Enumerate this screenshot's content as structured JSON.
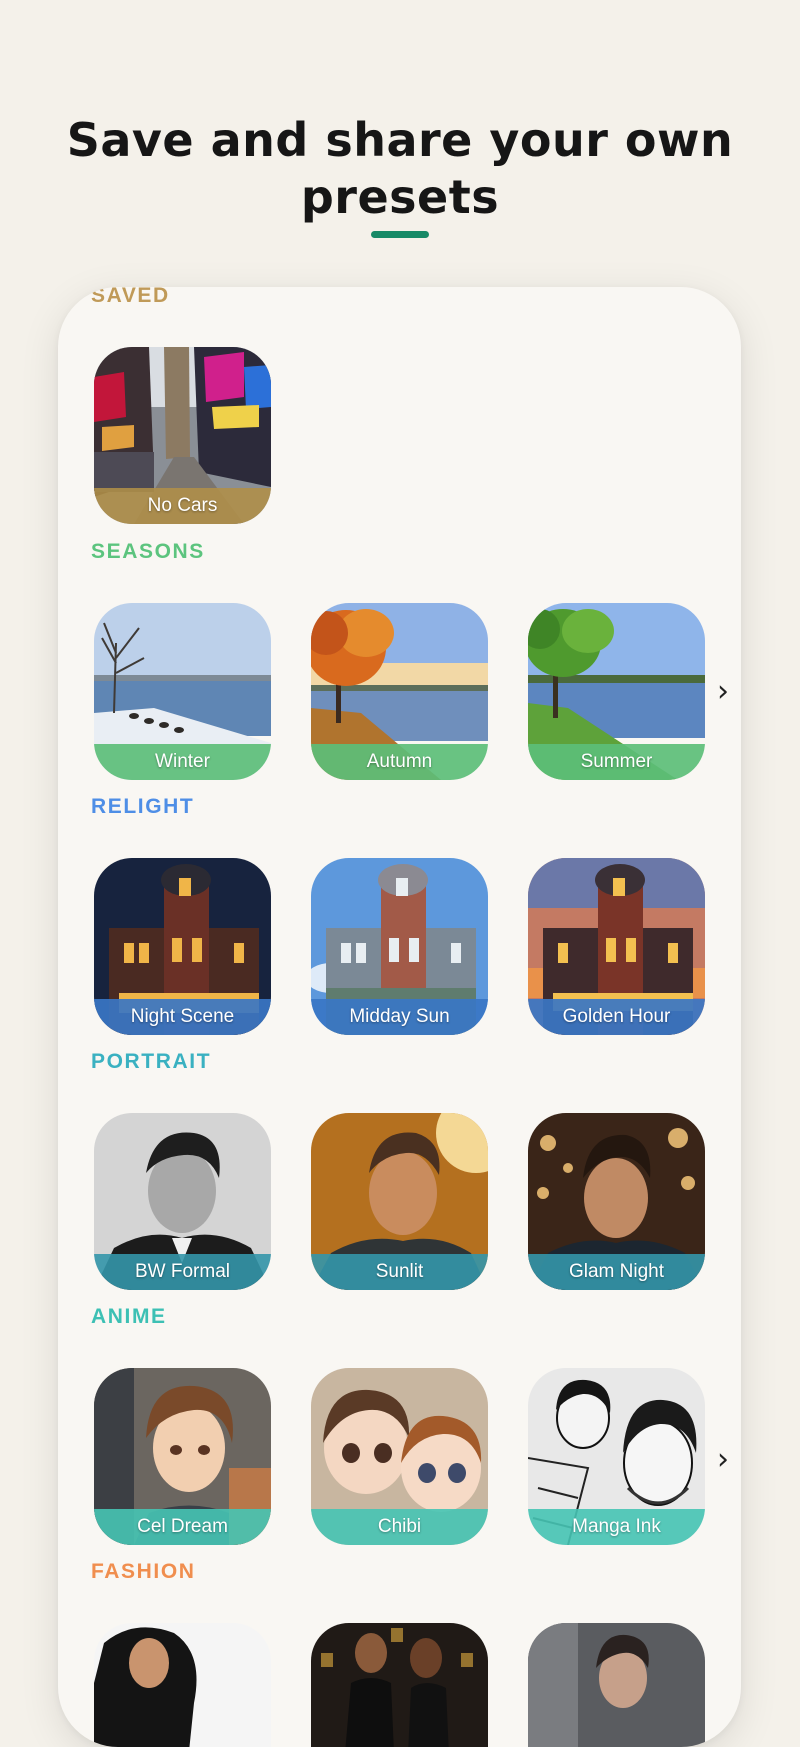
{
  "headline": {
    "line1": "Save and share your own",
    "line2": "presets"
  },
  "colors": {
    "headline_underline": "#178a67",
    "saved": "#c09a58",
    "seasons": "#5cc47e",
    "relight": "#4e8ee6",
    "portrait": "#3ab1c1",
    "anime": "#3dc0b4",
    "fashion": "#f08e4e"
  },
  "sections": {
    "saved": {
      "title": "SAVED",
      "tiles": [
        "No Cars"
      ]
    },
    "seasons": {
      "title": "SEASONS",
      "tiles": [
        "Winter",
        "Autumn",
        "Summer"
      ]
    },
    "relight": {
      "title": "RELIGHT",
      "tiles": [
        "Night Scene",
        "Midday Sun",
        "Golden Hour"
      ]
    },
    "portrait": {
      "title": "PORTRAIT",
      "tiles": [
        "BW Formal",
        "Sunlit",
        "Glam Night"
      ]
    },
    "anime": {
      "title": "ANIME",
      "tiles": [
        "Cel Dream",
        "Chibi",
        "Manga Ink"
      ]
    },
    "fashion": {
      "title": "FASHION",
      "tiles": []
    }
  },
  "icons": {
    "more_arrow": "chevron-right-icon"
  }
}
